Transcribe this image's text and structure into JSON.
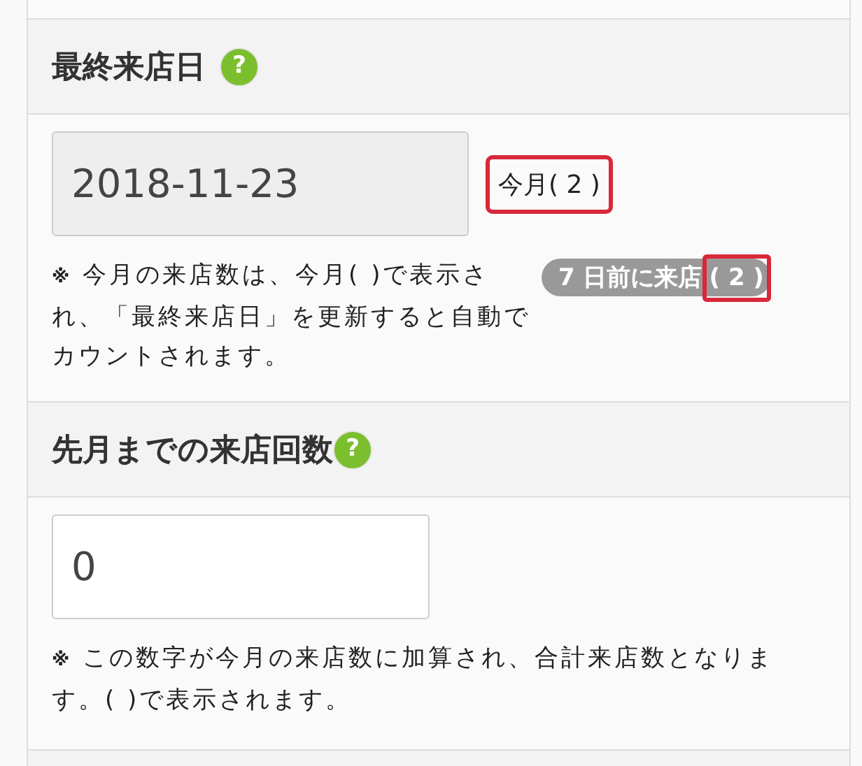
{
  "sections": [
    {
      "title": "最終来店日",
      "help": "?",
      "field": {
        "value": "2018-11-23",
        "disabled": true
      },
      "count": {
        "text": "今月( 2 )",
        "highlighted": true
      },
      "note": "今月の来店数は、今月( )で表示され、「最終来店日」を更新すると自動でカウントされます。",
      "note_mark": "※",
      "badge": {
        "label": "7 日前に来店",
        "count": "( 2 )",
        "highlighted": true
      }
    },
    {
      "title": "先月までの来店回数",
      "help": "?",
      "field": {
        "value": "0",
        "disabled": false
      },
      "note": "この数字が今月の来店数に加算され、合計来店数となります。( )で表示されます。",
      "note_mark": "※"
    }
  ]
}
